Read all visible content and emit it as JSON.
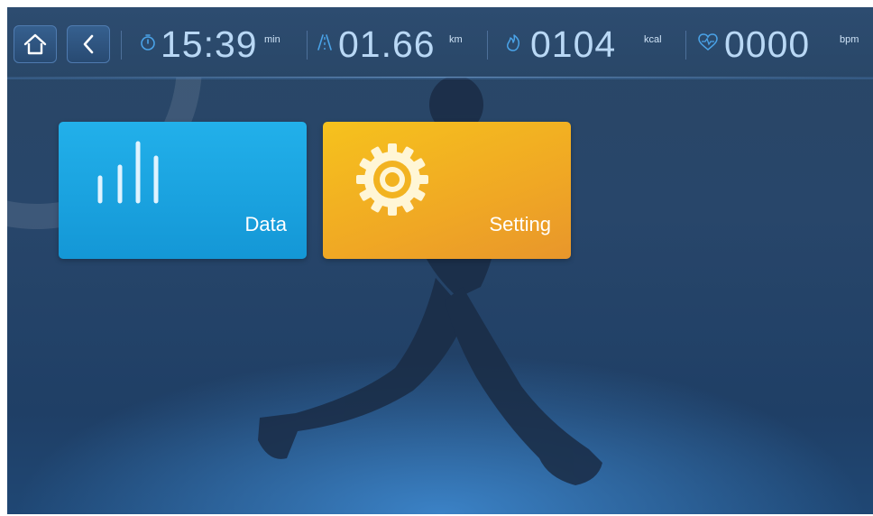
{
  "status": {
    "time": {
      "value": "15:39",
      "unit": "min"
    },
    "distance": {
      "value": "01.66",
      "unit": "km"
    },
    "calories": {
      "value": "0104",
      "unit": "kcal"
    },
    "heart_rate": {
      "value": "0000",
      "unit": "bpm"
    }
  },
  "tiles": [
    {
      "label": "Data",
      "icon": "bar-chart-icon",
      "color": "#1fa8e4"
    },
    {
      "label": "Setting",
      "icon": "gear-icon",
      "color": "#f2b320"
    }
  ],
  "colors": {
    "background": "#253f63",
    "accent": "#4aa3e8",
    "stat_text": "#b9d8f5"
  }
}
